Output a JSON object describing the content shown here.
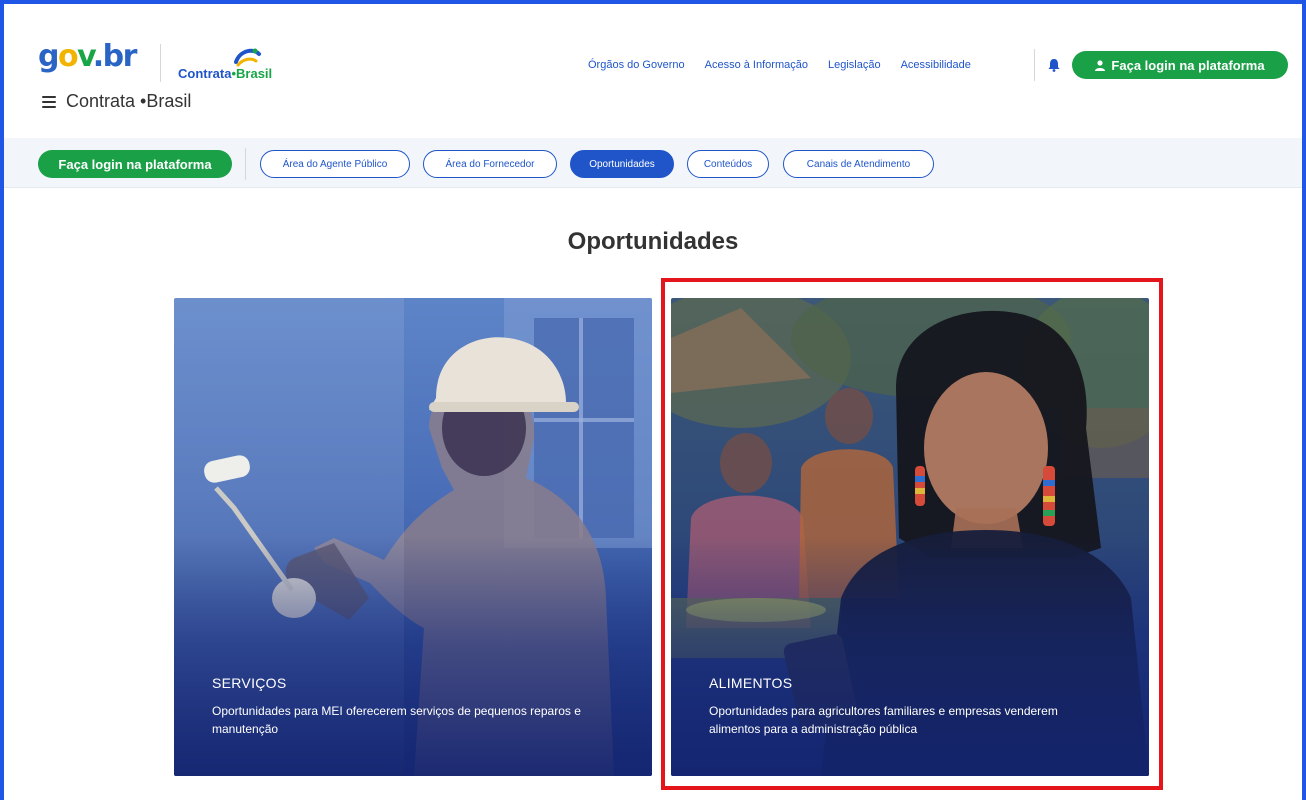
{
  "header": {
    "logo_gov": {
      "g": "g",
      "o": "o",
      "v": "v",
      "dot": ".",
      "br": "br"
    },
    "logo_contrata": {
      "contrata": "Contrata",
      "dot": "•",
      "brasil": "Brasil"
    },
    "site_title": "Contrata •Brasil",
    "top_links": [
      "Órgãos do Governo",
      "Acesso à Informação",
      "Legislação",
      "Acessibilidade"
    ],
    "login_label": "Faça login na plataforma"
  },
  "navbar": {
    "login_label": "Faça login na plataforma",
    "items": [
      {
        "label": "Área do Agente Público"
      },
      {
        "label": "Área do Fornecedor"
      },
      {
        "label": "Oportunidades",
        "active": true
      },
      {
        "label": "Conteúdos"
      },
      {
        "label": "Canais de Atendimento"
      }
    ]
  },
  "main": {
    "title": "Oportunidades",
    "cards": [
      {
        "heading": "SERVIÇOS",
        "description": "Oportunidades para MEI oferecerem serviços de pequenos reparos e manutenção"
      },
      {
        "heading": "ALIMENTOS",
        "description": "Oportunidades para agricultores familiares e empresas venderem alimentos para a administração pública"
      }
    ]
  },
  "colors": {
    "brand_blue": "#1f55c9",
    "brand_green": "#1aa047",
    "highlight_red": "#e4161b",
    "frame_blue": "#1f56e6"
  }
}
